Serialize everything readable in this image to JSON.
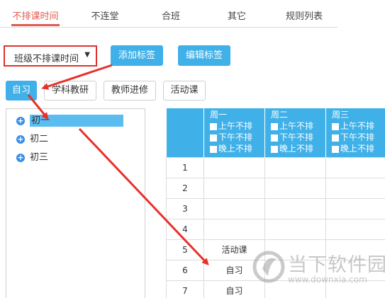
{
  "tabs": [
    {
      "label": "不排课时间",
      "active": true
    },
    {
      "label": "不连堂",
      "active": false
    },
    {
      "label": "合班",
      "active": false
    },
    {
      "label": "其它",
      "active": false
    },
    {
      "label": "规则列表",
      "active": false
    }
  ],
  "toolbar": {
    "select_value": "班级不排课时间",
    "add_tag_label": "添加标签",
    "edit_tag_label": "编辑标签"
  },
  "tags": [
    "自习",
    "学科教研",
    "教师进修",
    "活动课"
  ],
  "tree": {
    "items": [
      {
        "label": "初一",
        "selected": true
      },
      {
        "label": "初二",
        "selected": false
      },
      {
        "label": "初三",
        "selected": false
      }
    ]
  },
  "grid": {
    "days": [
      {
        "name": "周一",
        "options": [
          "上午不排",
          "下午不排",
          "晚上不排"
        ]
      },
      {
        "name": "周二",
        "options": [
          "上午不排",
          "下午不排",
          "晚上不排"
        ]
      },
      {
        "name": "周三",
        "options": [
          "上午不排",
          "下午不排",
          "晚上不排"
        ]
      }
    ],
    "rows": [
      {
        "num": "1",
        "cells": [
          "",
          "",
          ""
        ]
      },
      {
        "num": "2",
        "cells": [
          "",
          "",
          ""
        ]
      },
      {
        "num": "3",
        "cells": [
          "",
          "",
          ""
        ]
      },
      {
        "num": "4",
        "cells": [
          "",
          "",
          ""
        ]
      },
      {
        "num": "5",
        "cells": [
          "活动课",
          "",
          ""
        ]
      },
      {
        "num": "6",
        "cells": [
          "自习",
          "",
          ""
        ]
      },
      {
        "num": "7",
        "cells": [
          "自习",
          "",
          ""
        ]
      }
    ]
  },
  "watermark": {
    "text": "当下软件园",
    "url": "www.downxia.com"
  },
  "colors": {
    "accent": "#3fb0e8",
    "active_tab": "#e05a4e",
    "highlight": "#e0322a"
  }
}
